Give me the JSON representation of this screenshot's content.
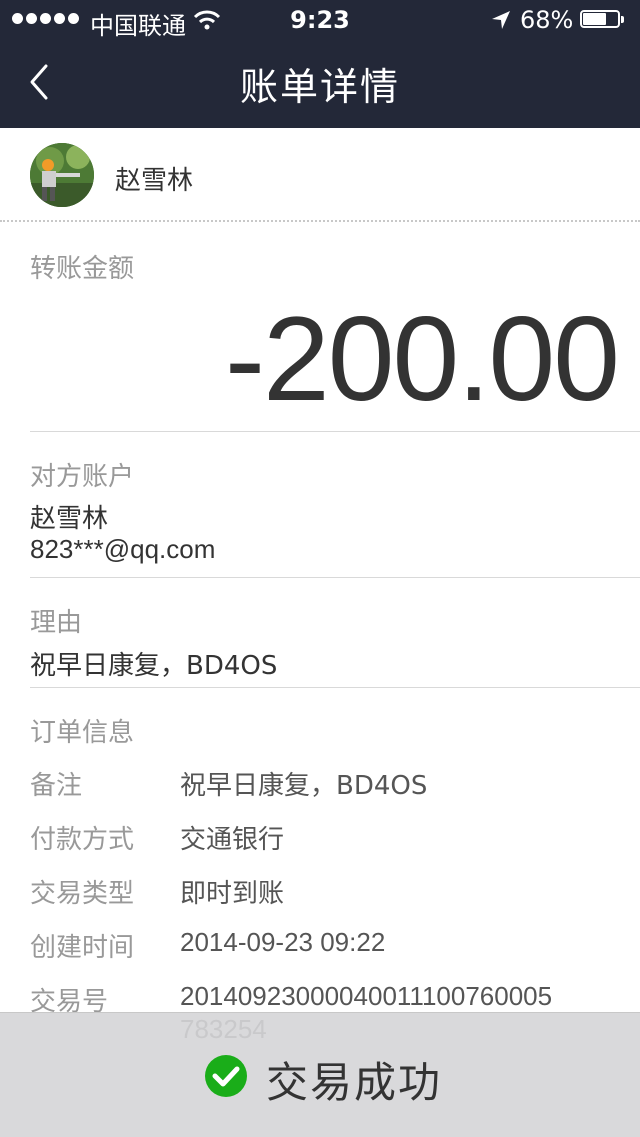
{
  "status_bar": {
    "carrier": "中国联通",
    "time": "9:23",
    "battery_percent": "68%",
    "battery_level": 0.68,
    "signal_dots": 5
  },
  "nav": {
    "title": "账单详情",
    "back_icon": "chevron-left-icon"
  },
  "payee": {
    "name": "赵雪林"
  },
  "amount": {
    "label": "转账金额",
    "value": "-200.00"
  },
  "counterparty": {
    "label": "对方账户",
    "name": "赵雪林",
    "account": "823***@qq.com"
  },
  "reason": {
    "label": "理由",
    "value": "祝早日康复，BD4OS"
  },
  "order": {
    "label": "订单信息",
    "rows": [
      {
        "key": "备注",
        "value": "祝早日康复，BD4OS"
      },
      {
        "key": "付款方式",
        "value": "交通银行"
      },
      {
        "key": "交易类型",
        "value": "即时到账"
      },
      {
        "key": "创建时间",
        "value": "2014-09-23 09:22"
      },
      {
        "key": "交易号",
        "value": "20140923000040011100760005",
        "value_cont": "783254"
      }
    ]
  },
  "footer": {
    "status": "交易成功",
    "icon": "check-circle-icon",
    "accent": "#1aad19"
  }
}
